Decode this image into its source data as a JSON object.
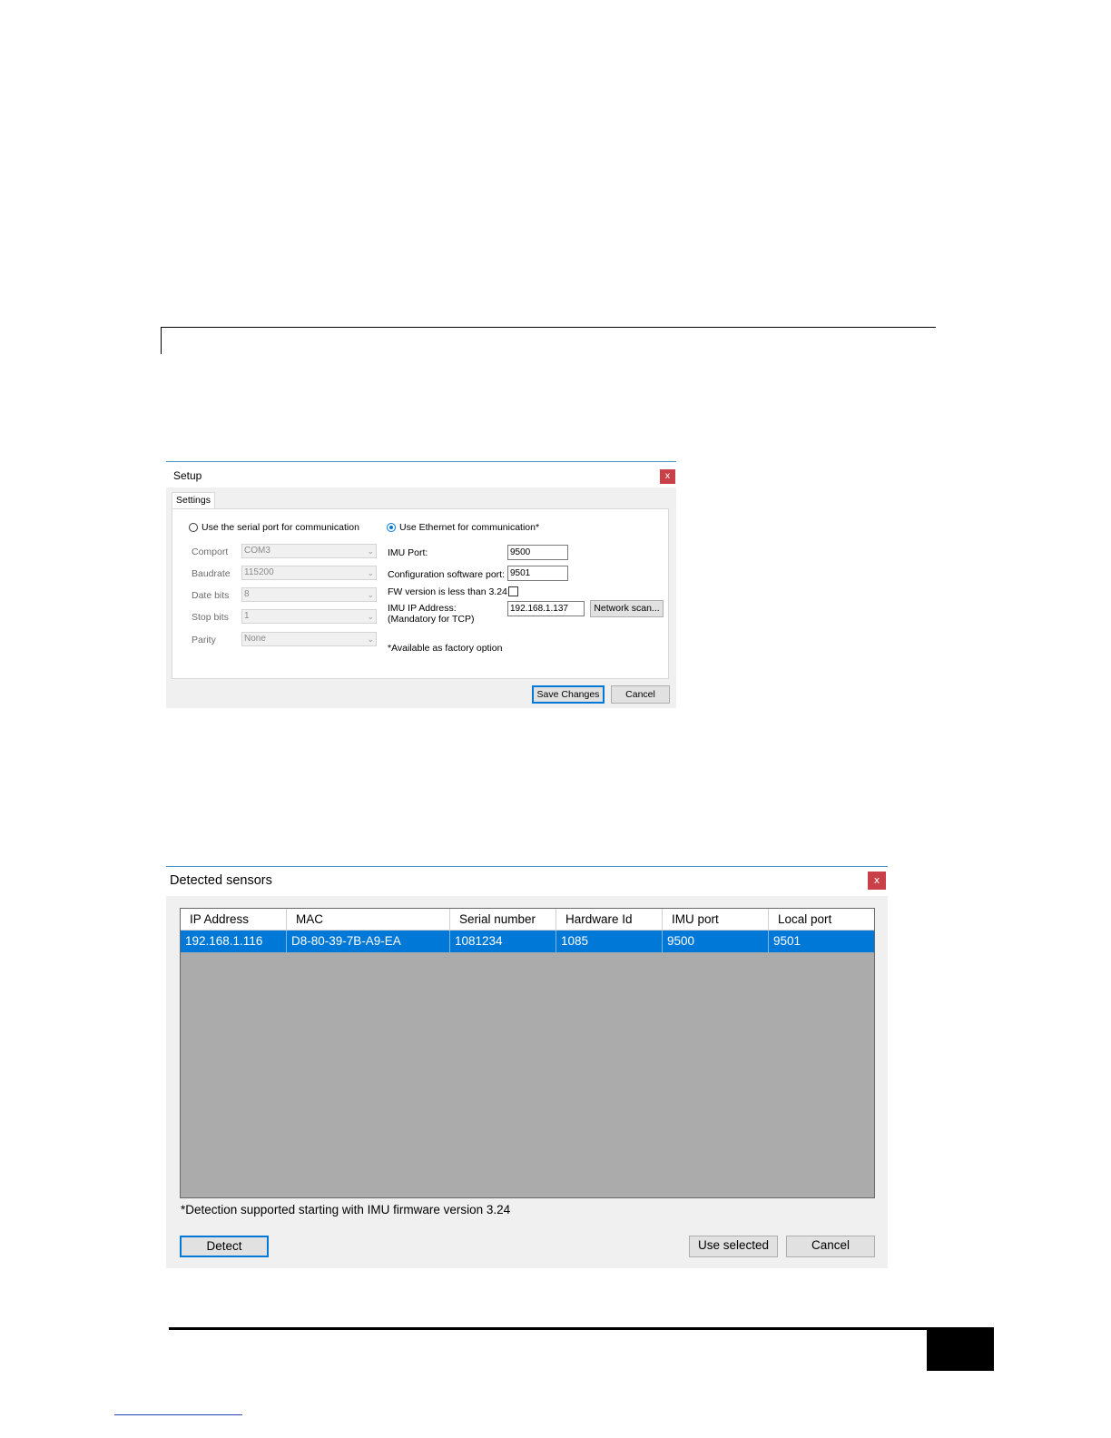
{
  "setup_dialog": {
    "title": "Setup",
    "close_glyph": "x",
    "tab_label": "Settings",
    "serial": {
      "radio_label": "Use the serial port for communication",
      "fields": [
        {
          "label": "Comport",
          "value": "COM3"
        },
        {
          "label": "Baudrate",
          "value": "115200"
        },
        {
          "label": "Date bits",
          "value": "8"
        },
        {
          "label": "Stop bits",
          "value": "1"
        },
        {
          "label": "Parity",
          "value": "None"
        }
      ]
    },
    "ethernet": {
      "radio_label": "Use Ethernet for communication*",
      "imu_port_label": "IMU Port:",
      "imu_port_value": "9500",
      "config_port_label": "Configuration software port:",
      "config_port_value": "9501",
      "fw_label": "FW version is less than 3.24",
      "fw_checked": false,
      "ip_label": "IMU IP Address:",
      "ip_sublabel": "(Mandatory for TCP)",
      "ip_value": "192.168.1.137",
      "network_scan_label": "Network scan...",
      "note": "*Available as factory option"
    },
    "selected_mode": "ethernet",
    "save_label": "Save Changes",
    "cancel_label": "Cancel"
  },
  "detected_dialog": {
    "title": "Detected sensors",
    "close_glyph": "x",
    "columns": [
      "IP Address",
      "MAC",
      "Serial number",
      "Hardware Id",
      "IMU port",
      "Local port"
    ],
    "rows": [
      [
        "192.168.1.116",
        "D8-80-39-7B-A9-EA",
        "1081234",
        "1085",
        "9500",
        "9501"
      ]
    ],
    "footnote": "*Detection supported starting with IMU firmware version 3.24",
    "detect_label": "Detect",
    "use_selected_label": "Use selected",
    "cancel_label": "Cancel"
  },
  "colors": {
    "selection": "#0078d7",
    "close_button": "#c94048",
    "grid_background": "#ababab"
  }
}
